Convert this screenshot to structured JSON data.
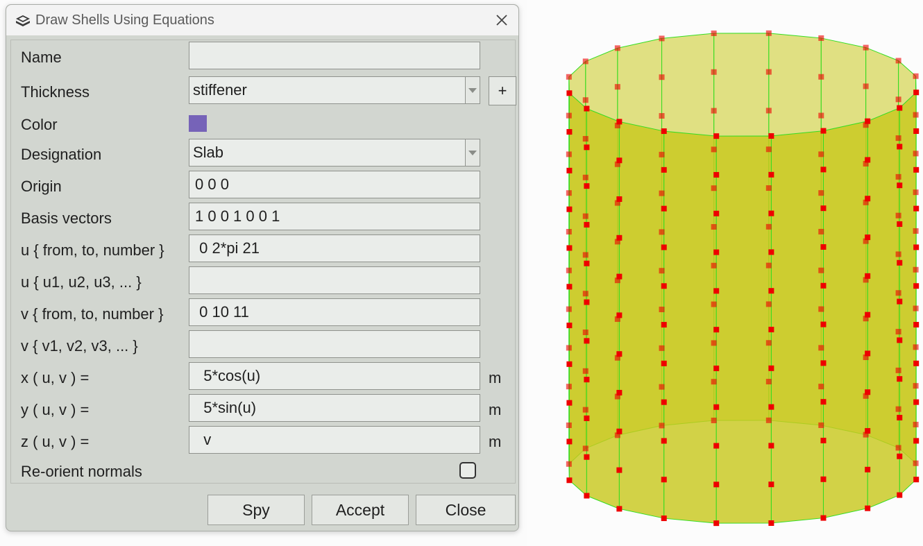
{
  "dialog": {
    "title": "Draw Shells Using Equations",
    "close_icon": "close-icon",
    "app_icon": "shell-icon"
  },
  "form": {
    "name": {
      "label": "Name",
      "value": ""
    },
    "thickness": {
      "label": "Thickness",
      "value": "stiffener",
      "add_label": "+"
    },
    "color": {
      "label": "Color",
      "swatch": "#7663b8"
    },
    "designation": {
      "label": "Designation",
      "value": "Slab"
    },
    "origin": {
      "label": "Origin",
      "value": "0 0 0"
    },
    "basis": {
      "label": "Basis vectors",
      "value": "1 0 0 1 0 0 1"
    },
    "u_range": {
      "label": "u { from, to, number }",
      "value": " 0 2*pi 21"
    },
    "u_list": {
      "label": "u { u1, u2, u3, ... }",
      "value": ""
    },
    "v_range": {
      "label": "v { from, to, number }",
      "value": " 0 10 11"
    },
    "v_list": {
      "label": "v { v1, v2, v3, ... }",
      "value": ""
    },
    "x_eq": {
      "label": "x ( u, v ) =",
      "value": "  5*cos(u)",
      "unit": "m"
    },
    "y_eq": {
      "label": "y ( u, v ) =",
      "value": "  5*sin(u)",
      "unit": "m"
    },
    "z_eq": {
      "label": "z ( u, v ) =",
      "value": "  v",
      "unit": "m"
    },
    "reorient": {
      "label": "Re-orient normals",
      "checked": false
    }
  },
  "buttons": {
    "spy": "Spy",
    "accept": "Accept",
    "close": "Close"
  },
  "model": {
    "shell_fill": "#c8c81e",
    "edge_color": "#33dd22",
    "node_color": "#ee0000",
    "radius": 5,
    "height": 10,
    "u_divisions": 21,
    "v_divisions": 11
  }
}
